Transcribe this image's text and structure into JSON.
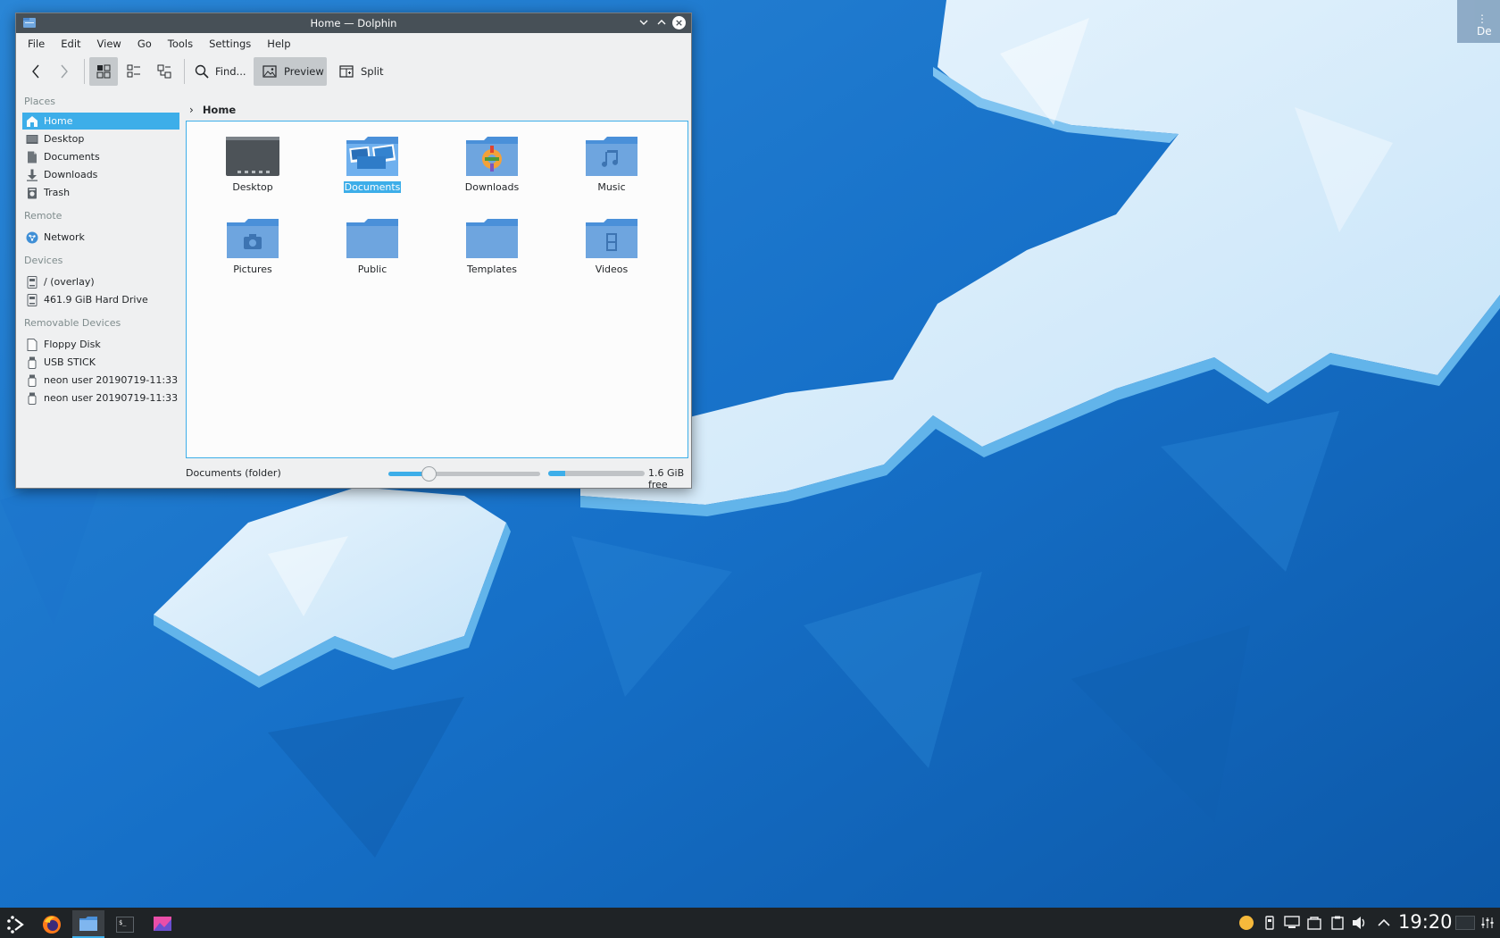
{
  "desktop": {
    "toolbox_label": "De"
  },
  "window": {
    "title": "Home — Dolphin",
    "menu": [
      "File",
      "Edit",
      "View",
      "Go",
      "Tools",
      "Settings",
      "Help"
    ],
    "toolbar": {
      "find_label": "Find...",
      "preview_label": "Preview",
      "split_label": "Split"
    },
    "places": {
      "sections": {
        "places": "Places",
        "remote": "Remote",
        "devices": "Devices",
        "removable": "Removable Devices"
      },
      "items": {
        "home": "Home",
        "desktop": "Desktop",
        "documents": "Documents",
        "downloads": "Downloads",
        "trash": "Trash",
        "network": "Network",
        "overlay": "/ (overlay)",
        "hard_drive": "461.9 GiB Hard Drive",
        "floppy": "Floppy Disk",
        "usb_stick": "USB STICK",
        "neon1": "neon user 20190719-11:33",
        "neon2": "neon user 20190719-11:33"
      }
    },
    "breadcrumb": {
      "current": "Home"
    },
    "files": {
      "desktop": "Desktop",
      "documents": "Documents",
      "downloads": "Downloads",
      "music": "Music",
      "pictures": "Pictures",
      "public": "Public",
      "templates": "Templates",
      "videos": "Videos"
    },
    "selected_file": "Documents",
    "status": {
      "text": "Documents (folder)",
      "free_space": "1.6 GiB free",
      "used_fraction": 0.18,
      "zoom_fraction": 0.27
    }
  },
  "taskbar": {
    "clock": "19:20"
  },
  "colors": {
    "accent": "#3daee9",
    "titlebar": "#475057",
    "window_bg": "#eff0f1",
    "panel": "#1f2326",
    "folder": "#5b9be0",
    "wallpaper_blue": "#1565b5"
  }
}
